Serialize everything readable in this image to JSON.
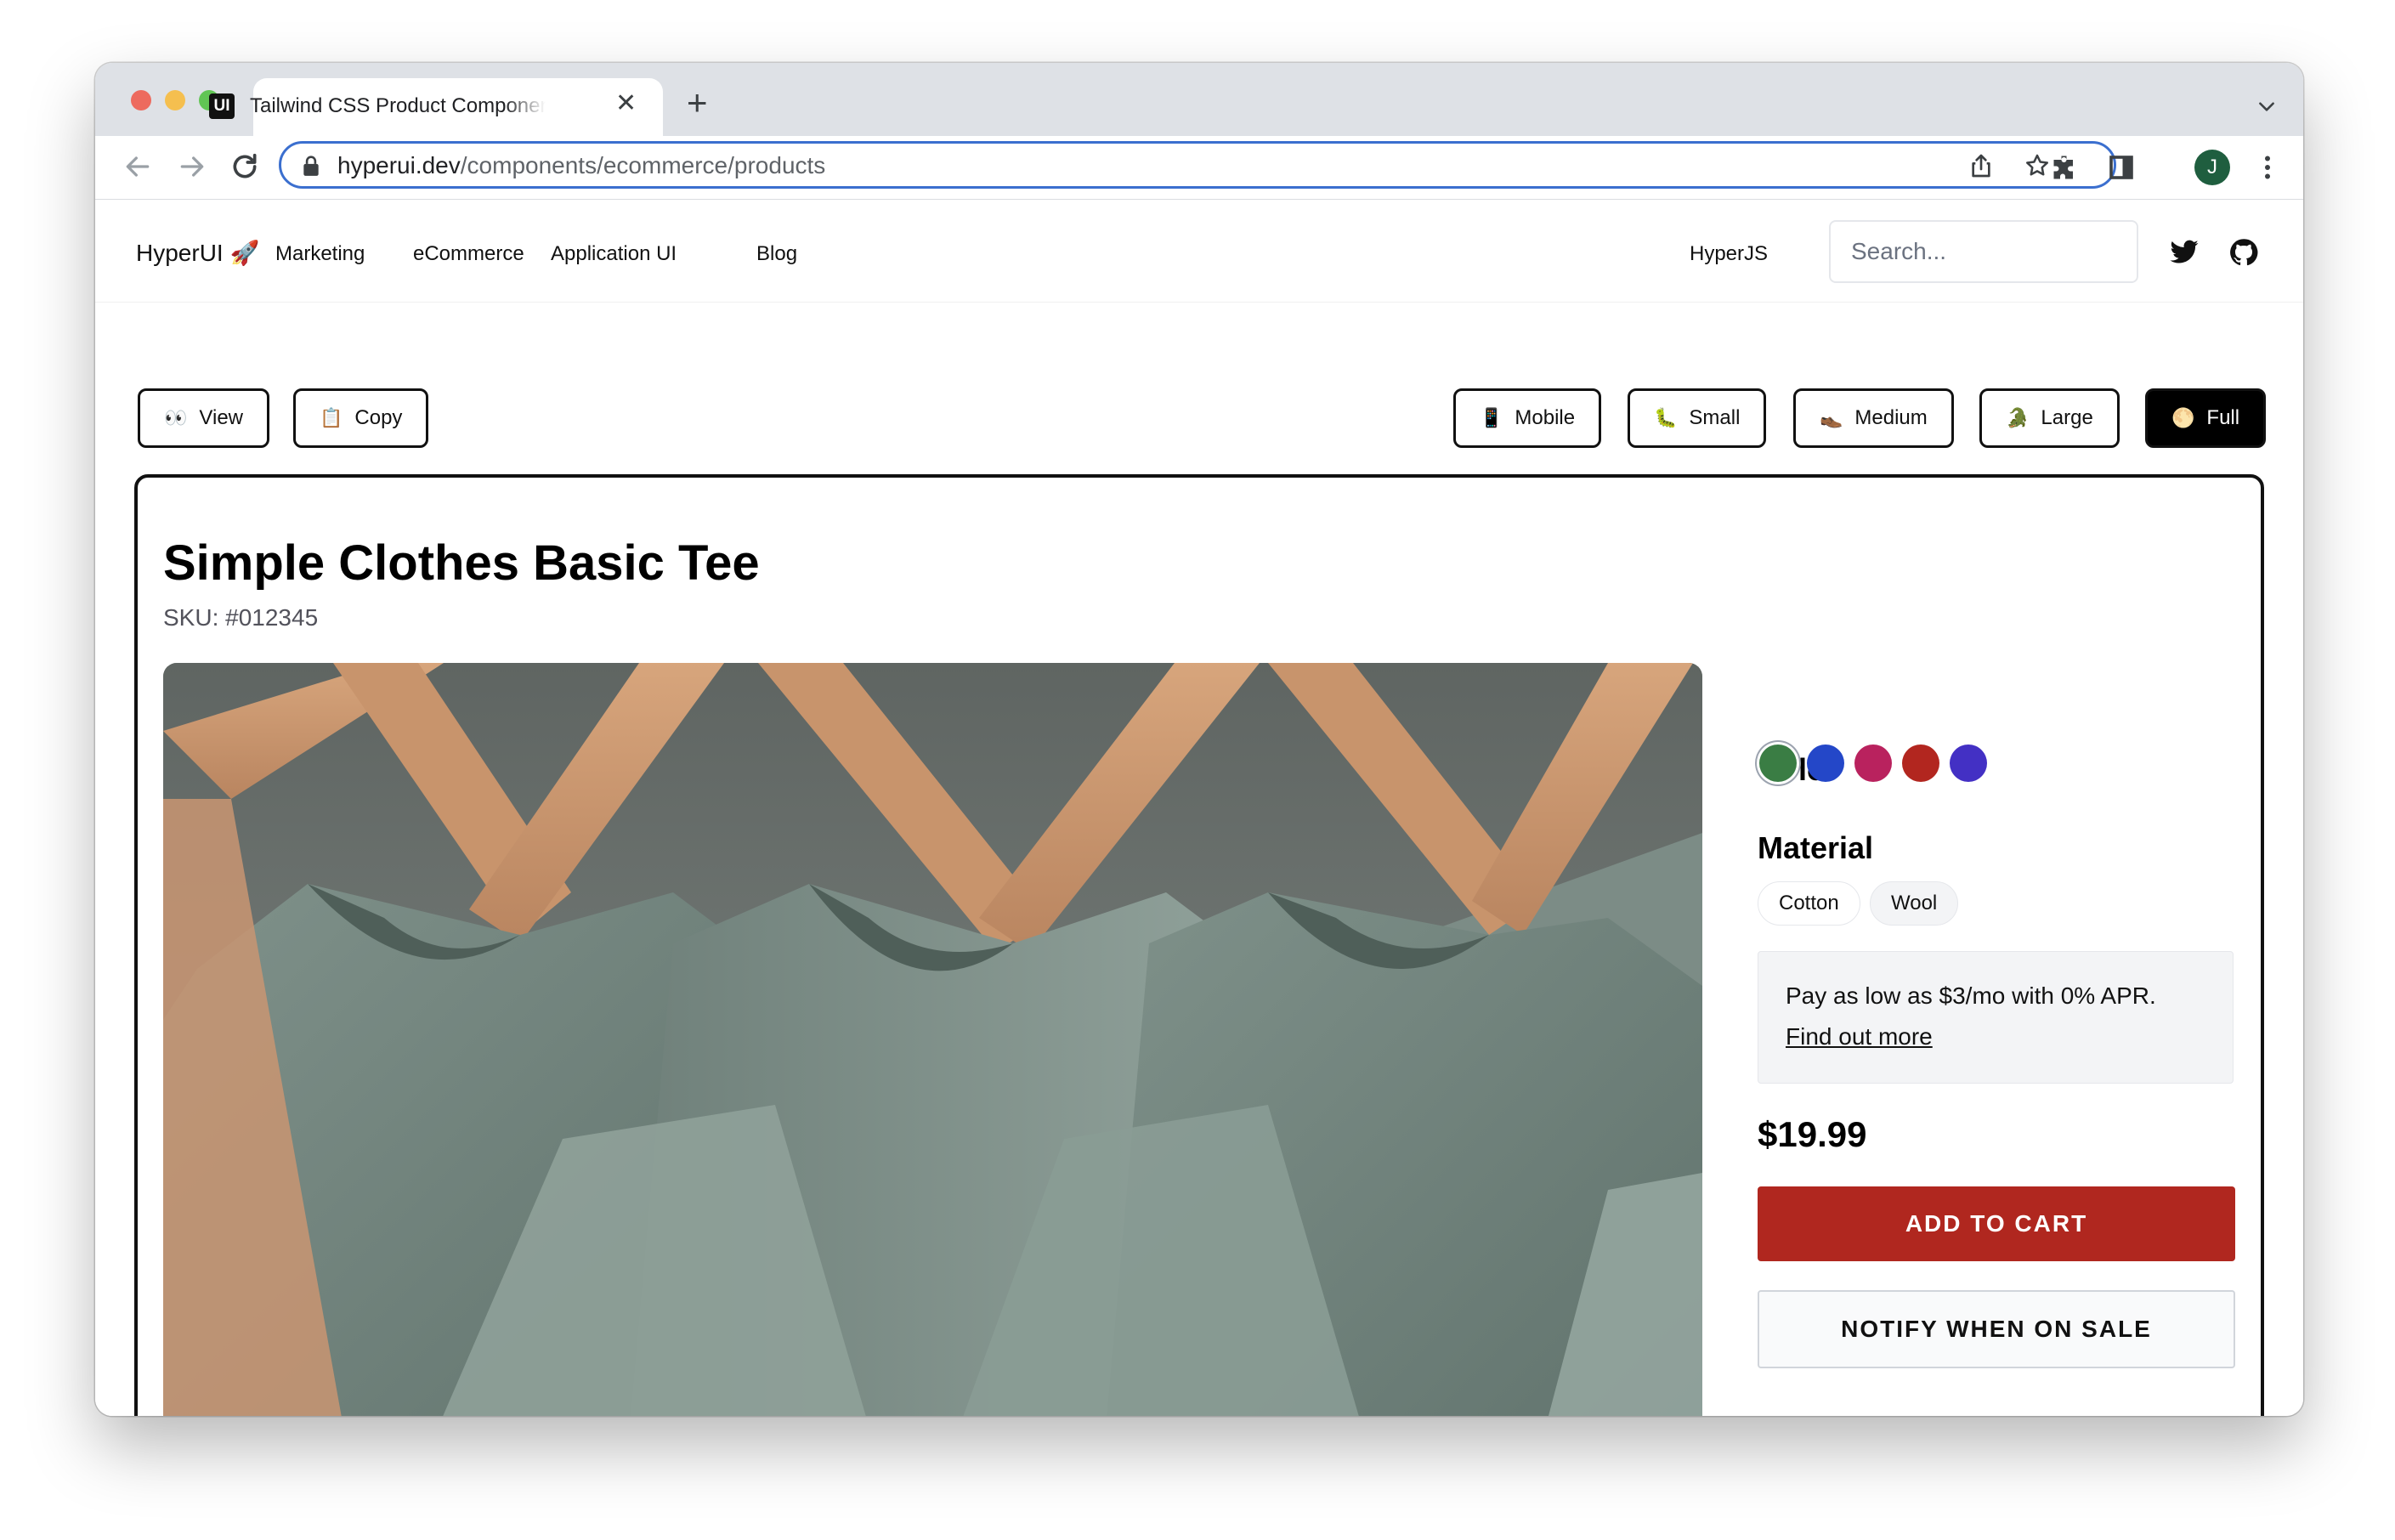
{
  "browser": {
    "tab_title": "Tailwind CSS Product Components | HyperUI",
    "favicon_text": "UI",
    "new_tab": "+",
    "close": "✕",
    "url_host": "hyperui.dev",
    "url_path": "/components/ecommerce/products",
    "profile_initial": "J"
  },
  "site": {
    "logo": "HyperUI 🚀",
    "nav": [
      "Marketing",
      "eCommerce",
      "Application UI",
      "Blog"
    ],
    "hyperjs": "HyperJS",
    "search_placeholder": "Search..."
  },
  "controls": {
    "view": {
      "emoji": "👀",
      "label": "View"
    },
    "copy": {
      "emoji": "📋",
      "label": "Copy"
    },
    "sizes": [
      {
        "emoji": "📱",
        "label": "Mobile"
      },
      {
        "emoji": "🐛",
        "label": "Small"
      },
      {
        "emoji": "👞",
        "label": "Medium"
      },
      {
        "emoji": "🐊",
        "label": "Large"
      },
      {
        "emoji": "🌕",
        "label": "Full"
      }
    ],
    "active_size": "Full"
  },
  "product": {
    "title": "Simple Clothes Basic Tee",
    "sku": "SKU: #012345",
    "color_heading": "Color",
    "colors": [
      "#3a7d44",
      "#2447c8",
      "#b9225e",
      "#b2261f",
      "#4330c4"
    ],
    "selected_color": "#3a7d44",
    "material_heading": "Material",
    "materials": [
      "Cotton",
      "Wool"
    ],
    "finance_text": "Pay as low as $3/mo with 0% APR.",
    "finance_link": "Find out more",
    "price": "$19.99",
    "add_to_cart": "ADD TO CART",
    "notify": "NOTIFY WHEN ON SALE"
  },
  "colors": {
    "accent_red": "#b0271f",
    "omnibox_focus": "#3b6fcf",
    "frame_border": "#111111"
  }
}
